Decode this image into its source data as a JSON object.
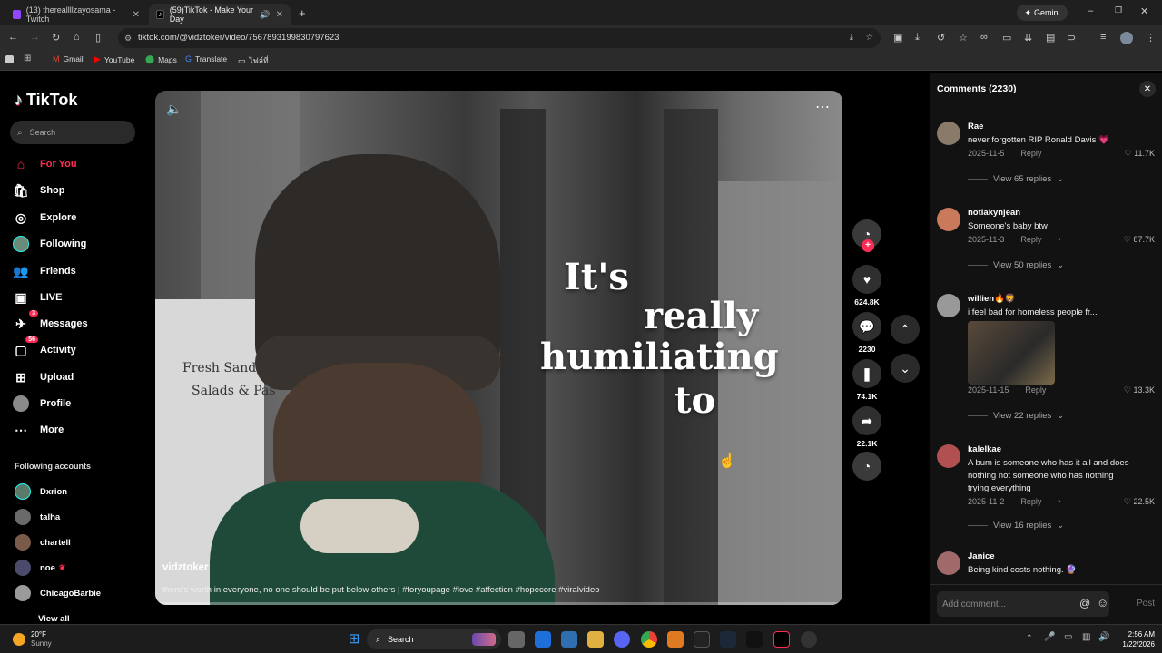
{
  "browser": {
    "tabs": [
      {
        "title": "(13) thereallllzayosama - Twitch",
        "color": "#9146ff"
      },
      {
        "title": "(59)TikTok - Make Your Day",
        "color": "#ffffff"
      }
    ],
    "url": "tiktok.com/@vidztoker/video/7567893199830797623",
    "gemini_label": "Gemini",
    "bookmarks": [
      "Gmail",
      "YouTube",
      "Maps",
      "Translate",
      "ไฟล์ที่"
    ]
  },
  "tiktok": {
    "logo": "TikTok",
    "search_placeholder": "Search",
    "nav": [
      {
        "label": "For You",
        "icon": "home-icon",
        "active": true
      },
      {
        "label": "Shop",
        "icon": "shop-icon"
      },
      {
        "label": "Explore",
        "icon": "compass-icon"
      },
      {
        "label": "Following",
        "icon": "following-avatar"
      },
      {
        "label": "Friends",
        "icon": "friends-icon"
      },
      {
        "label": "LIVE",
        "icon": "live-icon"
      },
      {
        "label": "Messages",
        "icon": "messages-icon",
        "badge": "3"
      },
      {
        "label": "Activity",
        "icon": "activity-icon",
        "badge": "56"
      },
      {
        "label": "Upload",
        "icon": "upload-icon"
      },
      {
        "label": "Profile",
        "icon": "profile-avatar"
      },
      {
        "label": "More",
        "icon": "more-icon"
      }
    ],
    "following_title": "Following accounts",
    "following_accounts": [
      "Dxrion",
      "talha",
      "chartell",
      "noe",
      "ChicagoBarbie"
    ],
    "view_all": "View all"
  },
  "video": {
    "caption_lines": [
      "It's",
      "really",
      "humiliating",
      "to"
    ],
    "username": "vidztoker",
    "description": "there's worth in everyone, no one should be put below others | #foryoupage #love #affection #hopecore #viralvideo",
    "sign_text_1": "Fresh Sandwi",
    "sign_text_2": "Salads & Pas"
  },
  "actions": {
    "likes": "624.8K",
    "comments": "2230",
    "saves": "74.1K",
    "shares": "22.1K"
  },
  "comments_panel": {
    "title": "Comments (2230)",
    "items": [
      {
        "name": "Rae",
        "text": "never forgotten RIP Ronald Davis 💗",
        "date": "2025-11-5",
        "reply": "Reply",
        "likes": "11.7K",
        "view_replies": "View 65 replies",
        "avatar": "#8a7a6a"
      },
      {
        "name": "notlakynjean",
        "text": "Someone's baby btw",
        "date": "2025-11-3",
        "reply": "Reply",
        "likes": "87.7K",
        "view_replies": "View 50 replies",
        "avatar": "#c97a5a"
      },
      {
        "name": "willien🔥🦁",
        "text": "i feel bad for homeless people fr...",
        "date": "2025-11-15",
        "reply": "Reply",
        "likes": "13.3K",
        "view_replies": "View 22 replies",
        "avatar": "#999"
      },
      {
        "name": "kalelkae",
        "text": "A bum is someone who has it all and does nothing not someone who has nothing trying everything",
        "date": "2025-11-2",
        "reply": "Reply",
        "likes": "22.5K",
        "view_replies": "View 16 replies",
        "avatar": "#b05050"
      },
      {
        "name": "Janice",
        "text": "Being kind costs nothing. 🔮",
        "avatar": "#a06a6a"
      }
    ],
    "input_placeholder": "Add comment...",
    "post_label": "Post"
  },
  "taskbar": {
    "weather_temp": "20°F",
    "weather_desc": "Sunny",
    "search_label": "Search",
    "time": "2:56 AM",
    "date": "1/22/2026"
  },
  "colors": {
    "accent": "#fe2c55",
    "background": "#000000",
    "panel": "#121212"
  }
}
